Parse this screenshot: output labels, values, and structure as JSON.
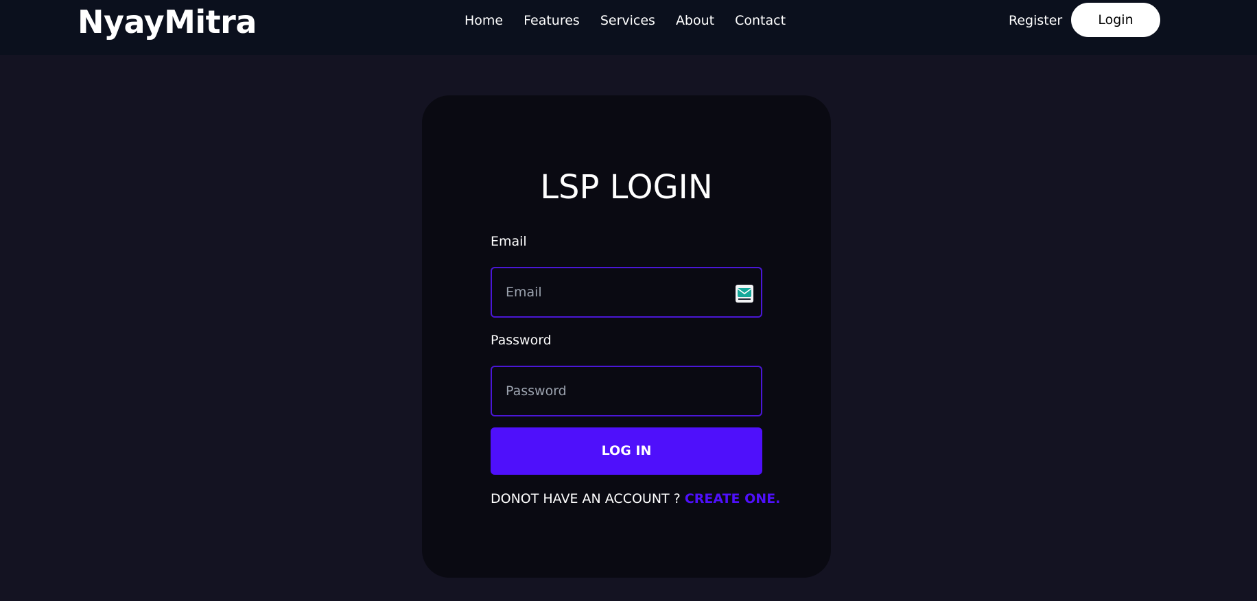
{
  "brand": {
    "name": "NyayMitra"
  },
  "nav": {
    "links": [
      {
        "label": "Home"
      },
      {
        "label": "Features"
      },
      {
        "label": "Services"
      },
      {
        "label": "About"
      },
      {
        "label": "Contact"
      }
    ],
    "register_label": "Register",
    "login_label": "Login"
  },
  "form": {
    "title": "LSP LOGIN",
    "email_label": "Email",
    "email_placeholder": "Email",
    "email_value": "",
    "password_label": "Password",
    "password_placeholder": "Password",
    "password_value": "",
    "submit_label": "LOG IN",
    "signup_prompt": "DONOT HAVE AN ACCOUNT ?",
    "signup_link": "CREATE ONE.",
    "email_icon": "mail-icon"
  },
  "colors": {
    "page_bg": "#141322",
    "nav_bg": "#0b101d",
    "card_bg": "#0a0a12",
    "accent": "#4f10fb",
    "field_border": "#4a17d6"
  }
}
